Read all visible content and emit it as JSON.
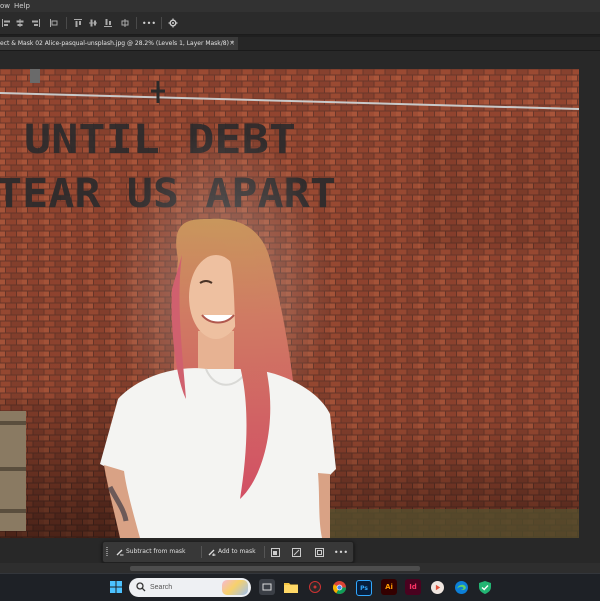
{
  "menu": {
    "items": [
      "ow",
      "Help"
    ]
  },
  "document_tab": {
    "title": "ect & Mask 02 Alice-pasqual-unsplash.jpg @ 28.2% (Levels 1, Layer Mask/8) *",
    "close_glyph": "×"
  },
  "photo": {
    "wall_text_line1": "UNTIL DEBT",
    "wall_text_line2": "TEAR US APART"
  },
  "context_bar": {
    "subtract_label": "Subtract from mask",
    "add_label": "Add to mask",
    "more_glyph": "•••"
  },
  "taskbar": {
    "search_placeholder": "Search",
    "apps": [
      "windows-start",
      "file-explorer",
      "dvd-app",
      "chrome",
      "photoshop",
      "illustrator",
      "indesign",
      "media-player",
      "edge",
      "security-app"
    ]
  },
  "colors": {
    "ps_dark": "#282828",
    "brick": "#9a4a33",
    "shirt": "#f4f4f2",
    "hair_pink": "#d2586a",
    "taskbar": "#1e2126"
  }
}
